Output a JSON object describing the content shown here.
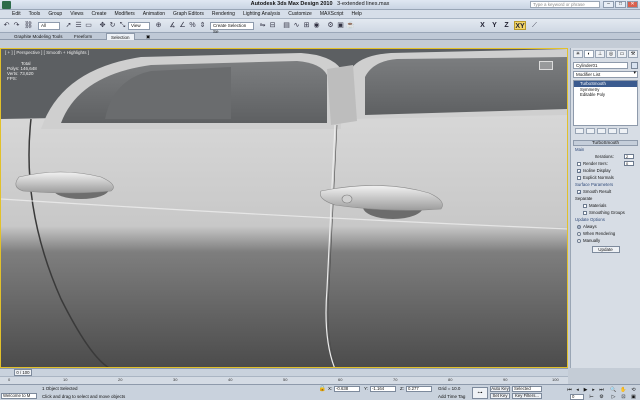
{
  "window": {
    "app_name": "Autodesk 3ds Max Design 2010",
    "file_name": "3-extended lines.max",
    "search_placeholder": "Type a keyword or phrase",
    "minimize": "–",
    "maximize": "□",
    "close": "✕"
  },
  "menu": [
    "Edit",
    "Tools",
    "Group",
    "Views",
    "Create",
    "Modifiers",
    "Animation",
    "Graph Editors",
    "Rendering",
    "Lighting Analysis",
    "Customize",
    "MAXScript",
    "Help"
  ],
  "toolbar": {
    "selection_filter": "All",
    "reference_coord": "View",
    "named_selection": "Create Selection Se",
    "axis_x": "X",
    "axis_y": "Y",
    "axis_z": "Z",
    "axis_xy": "XY"
  },
  "ribbon": {
    "tabs": [
      "Graphite Modeling Tools",
      "Freeform",
      "Selection"
    ]
  },
  "viewport": {
    "label": "[ + ] [ Perspective ] [ Smooth + Highlights ]",
    "stats_title": "Total",
    "stats_polys_label": "Polys:",
    "stats_polys": "146,648",
    "stats_verts_label": "Verts:",
    "stats_verts": "73,620",
    "fps_label": "FPS:"
  },
  "command_panel": {
    "object_name": "Cylinder01",
    "modifier_list": "Modifier List",
    "stack": [
      "TurboSmooth",
      "Symmetry",
      "Editable Poly"
    ],
    "rollout_title": "TurboSmooth",
    "main_section": "Main",
    "iterations_label": "Iterations:",
    "iterations_value": "2",
    "render_iters_label": "Render Iters:",
    "render_iters_value": "0",
    "isoline_label": "Isoline Display",
    "explicit_normals_label": "Explicit Normals",
    "surface_section": "Surface Parameters",
    "smooth_result_label": "Smooth Result",
    "separate_label": "Separate",
    "materials_label": "Materials",
    "smoothing_groups_label": "Smoothing Groups",
    "update_section": "Update Options",
    "always_label": "Always",
    "when_rendering_label": "When Rendering",
    "manually_label": "Manually",
    "update_button": "Update"
  },
  "timeline": {
    "slider_label": "0 / 100",
    "ticks": [
      "0",
      "10",
      "20",
      "30",
      "40",
      "50",
      "60",
      "70",
      "80",
      "90",
      "100"
    ]
  },
  "status": {
    "selected": "1 Object Selected",
    "hint": "Click and drag to select and move objects",
    "listener": "Welcome to M",
    "x_label": "X:",
    "x_value": "-0.638",
    "y_label": "Y:",
    "y_value": "-1.164",
    "z_label": "Z:",
    "z_value": "0.277",
    "grid": "Grid = 10.0",
    "add_time_tag": "Add Time Tag",
    "auto_key": "Auto Key",
    "selected_dropdown": "Selected",
    "set_key": "Set Key",
    "key_filters": "Key Filters...",
    "frame": "0"
  }
}
